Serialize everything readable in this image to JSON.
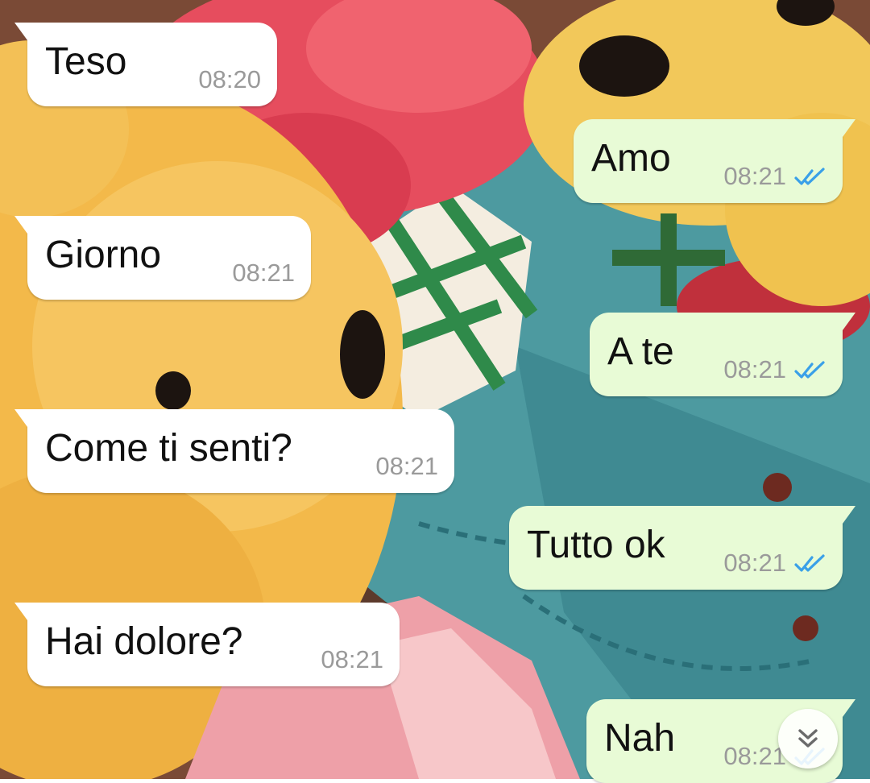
{
  "chat": {
    "messages": [
      {
        "direction": "incoming",
        "text": "Teso",
        "time": "08:20"
      },
      {
        "direction": "outgoing",
        "text": "Amo",
        "time": "08:21",
        "status": "read-double-check-icon"
      },
      {
        "direction": "incoming",
        "text": "Giorno",
        "time": "08:21"
      },
      {
        "direction": "outgoing",
        "text": "A te",
        "time": "08:21",
        "status": "read-double-check-icon"
      },
      {
        "direction": "incoming",
        "text": "Come ti senti?",
        "time": "08:21"
      },
      {
        "direction": "outgoing",
        "text": "Tutto ok",
        "time": "08:21",
        "status": "read-double-check-icon"
      },
      {
        "direction": "incoming",
        "text": "Hai dolore?",
        "time": "08:21"
      },
      {
        "direction": "outgoing",
        "text": "Nah",
        "time": "08:21",
        "status": "read-double-check-icon"
      }
    ]
  },
  "colors": {
    "incoming_bubble": "#ffffff",
    "outgoing_bubble": "#e8fbd6",
    "read_tick": "#3aa0e8",
    "timestamp": "#9a9a9a"
  },
  "scroll_button": {
    "icon": "double-chevron-down-icon"
  }
}
